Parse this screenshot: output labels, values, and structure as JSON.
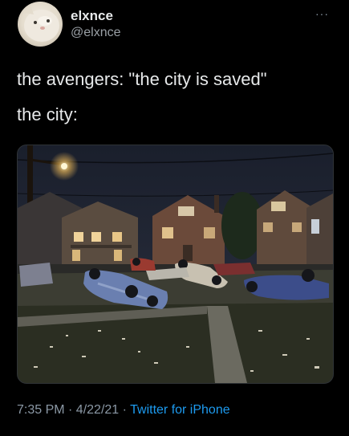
{
  "tweet": {
    "author": {
      "display_name": "elxnce",
      "handle": "@elxnce",
      "avatar_icon": "cat-avatar-icon"
    },
    "more_icon": "more-options-icon",
    "more_label": "···",
    "text_lines": [
      "the avengers: \"the city is saved\"",
      "the city:"
    ],
    "media": {
      "type": "photo"
    },
    "timestamp": "7:35 PM · 4/22/21",
    "separator": " · ",
    "source": "Twitter for iPhone"
  },
  "colors": {
    "background": "#000000",
    "text": "#e7e9ea",
    "secondary": "#8b98a5",
    "link": "#1d9bf0"
  }
}
